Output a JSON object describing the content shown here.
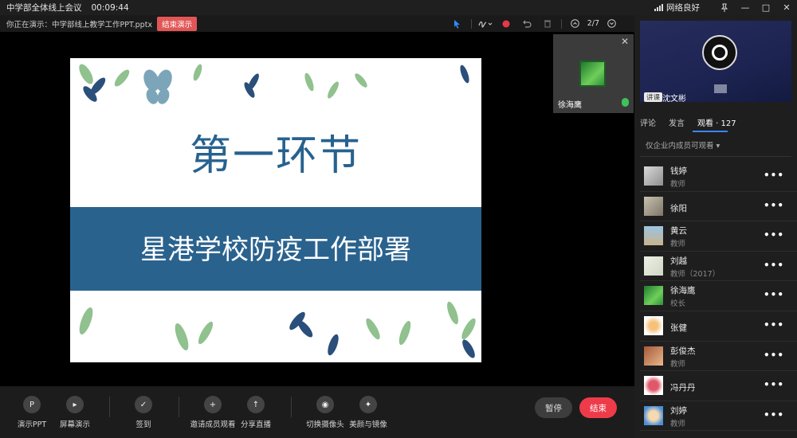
{
  "titlebar": {
    "title": "中学部全体线上会议",
    "timer": "00:09:44",
    "network": "网络良好",
    "pin_icon": "pin-icon",
    "minimize": "—",
    "maximize": "□",
    "close": "✕"
  },
  "presbar": {
    "presenting_text": "你正在演示：中学部线上教学工作PPT.pptx",
    "end_presentation": "结束演示",
    "page": "2/7"
  },
  "slide": {
    "heading": "第一环节",
    "subtitle": "星港学校防疫工作部署",
    "heading_color": "#27628f",
    "band_color": "#2a628e"
  },
  "speaker": {
    "name": "徐海鹰",
    "close": "✕"
  },
  "panel": {
    "video_tag": "讲课",
    "video_name": "沈文彬",
    "tabs": [
      "评论",
      "发言",
      "观看 · 127"
    ],
    "permission": "仅企业内成员可观看 ▾",
    "members": [
      {
        "name": "钱婷",
        "role": "教师"
      },
      {
        "name": "徐阳",
        "role": ""
      },
      {
        "name": "黄云",
        "role": "教师"
      },
      {
        "name": "刘越",
        "role": "教师（2017）"
      },
      {
        "name": "徐海鹰",
        "role": "校长"
      },
      {
        "name": "张健",
        "role": ""
      },
      {
        "name": "彭俊杰",
        "role": "教师"
      },
      {
        "name": "冯丹丹",
        "role": ""
      },
      {
        "name": "刘婷",
        "role": "教师"
      }
    ],
    "more": "•••"
  },
  "bottom": {
    "buttons": [
      "演示PPT",
      "屏幕演示",
      "签到",
      "邀请成员观看",
      "分享直播",
      "切换摄像头",
      "美颜与镜像"
    ],
    "pause": "暂停",
    "end": "结束"
  },
  "colors": {
    "end_red": "#ee3b4a",
    "accent_blue": "#3a86ff"
  }
}
